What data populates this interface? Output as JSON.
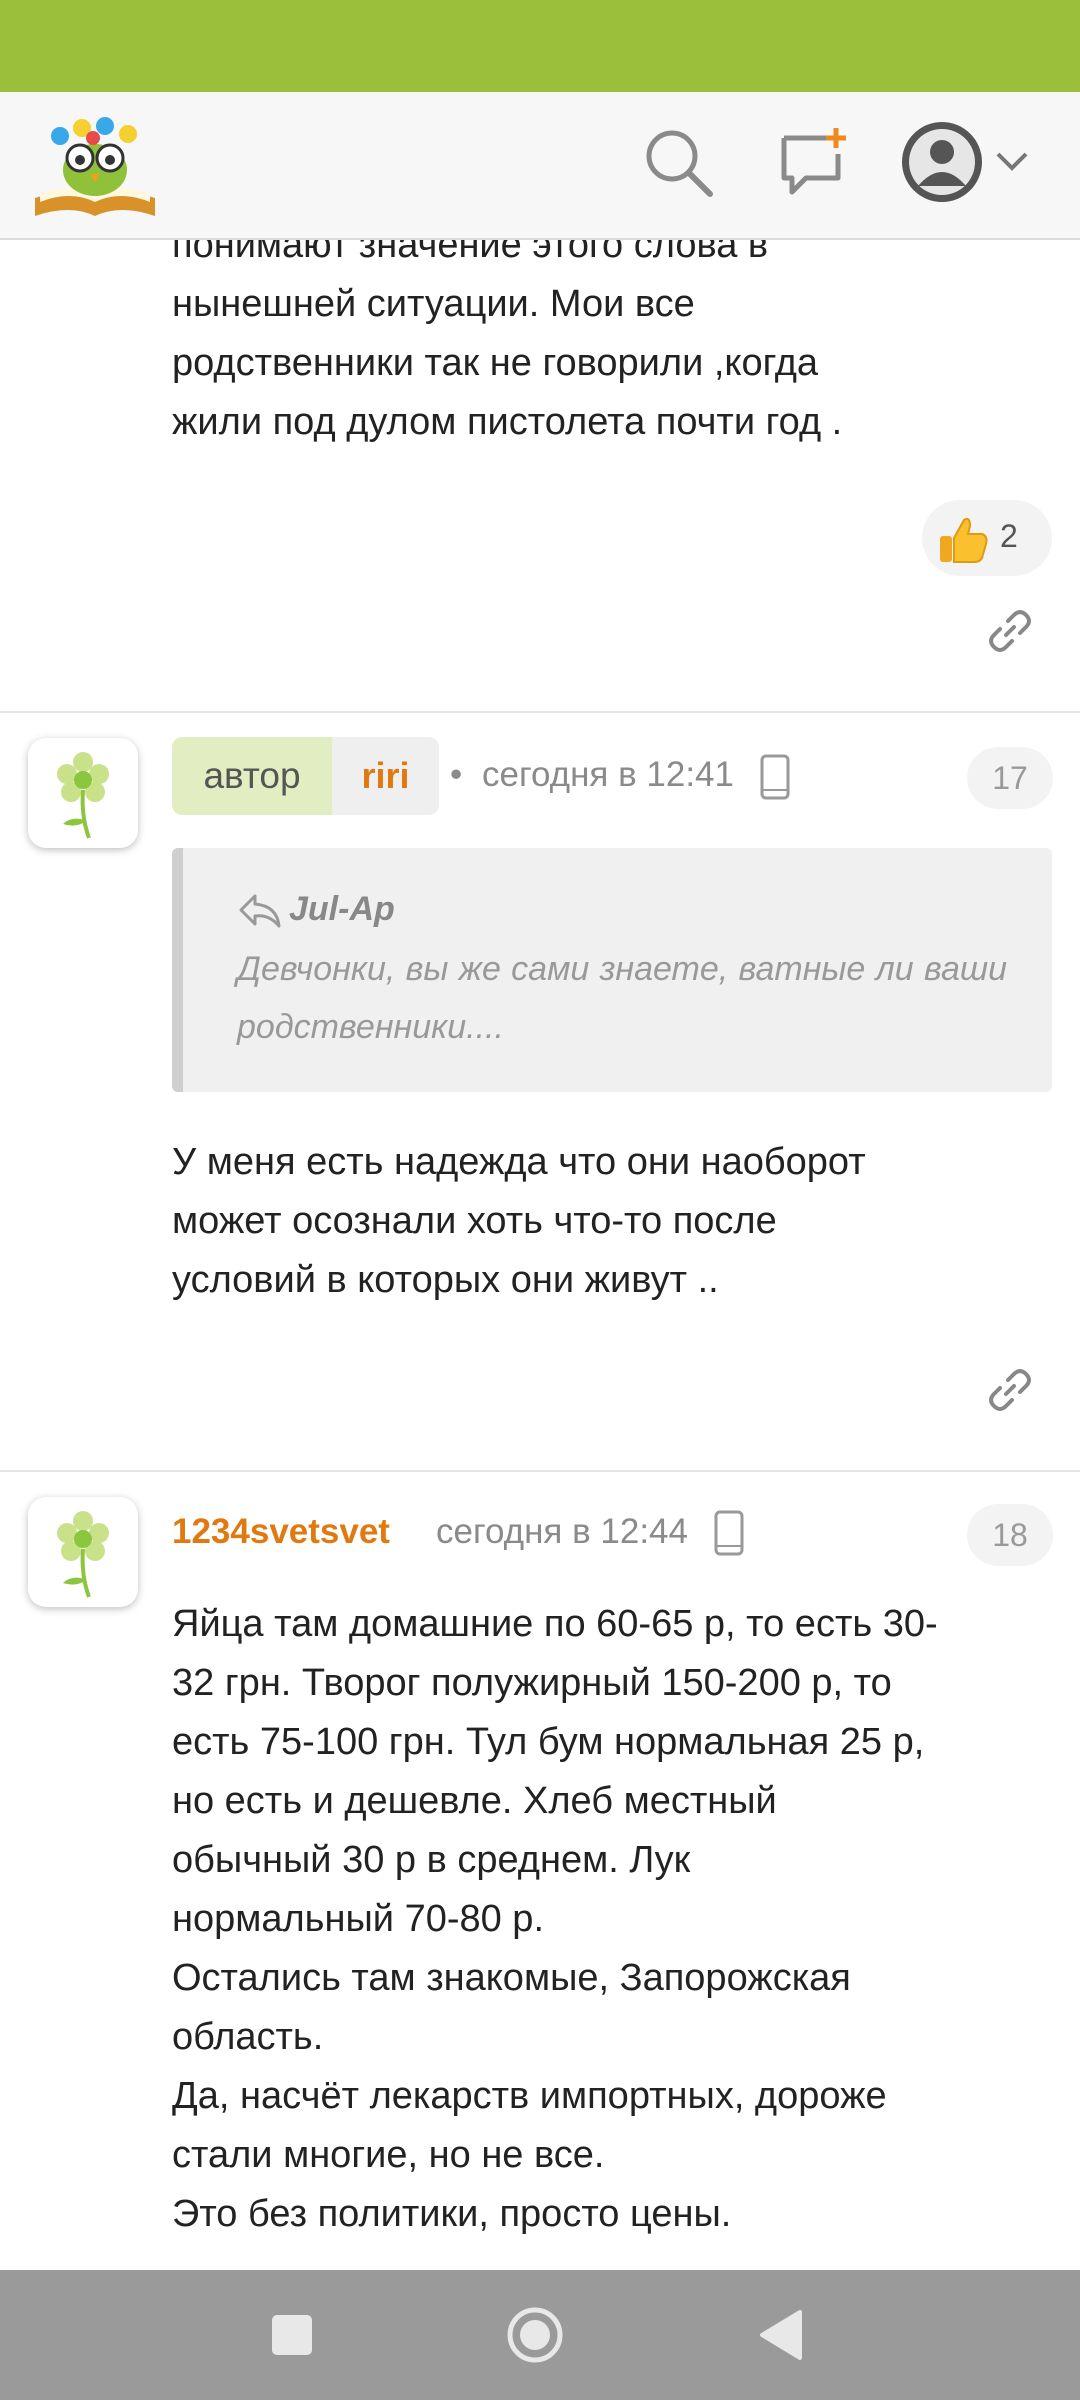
{
  "header": {
    "logo_icon": "owl-on-book-logo",
    "search_icon": "search-icon",
    "new_message_icon": "new-message-icon",
    "profile_icon": "profile-icon"
  },
  "posts": [
    {
      "lines": [
        "понимают значение этого слова в",
        "нынешней ситуации. Мои все",
        "родственники так не говорили ,когда",
        "жили под дулом пистолета почти год ."
      ],
      "likes": "2"
    },
    {
      "author_tag": "автор",
      "username": "riri",
      "time": "сегодня в 12:41",
      "number": "17",
      "quote": {
        "author": "Jul-Ap",
        "text": "Девчонки, вы же сами знаете, ватные ли ваши родственники...."
      },
      "lines": [
        "У меня есть надежда что они наоборот",
        "может осознали хоть что-то после",
        "условий в которых они живут .."
      ]
    },
    {
      "username": "1234svetsvet",
      "time": "сегодня в 12:44",
      "number": "18",
      "lines": [
        "Яйца там домашние по 60-65 р, то есть 30-",
        "32 грн. Творог полужирный 150-200 р, то",
        "есть 75-100 грн. Тул бум нормальная 25 р,",
        "но есть и дешевле. Хлеб местный",
        "обычный 30 р в среднем. Лук",
        "нормальный 70-80 р.",
        "Остались там знакомые, Запорожская",
        "область.",
        "Да, насчёт лекарств импортных, дороже",
        "стали многие, но не все.",
        "Это без политики, просто цены."
      ]
    }
  ],
  "colors": {
    "status_bar": "#9bbf3b",
    "username": "#e07a10",
    "author_tag_bg": "#e2eec2",
    "navbar": "#9a9a9a"
  }
}
